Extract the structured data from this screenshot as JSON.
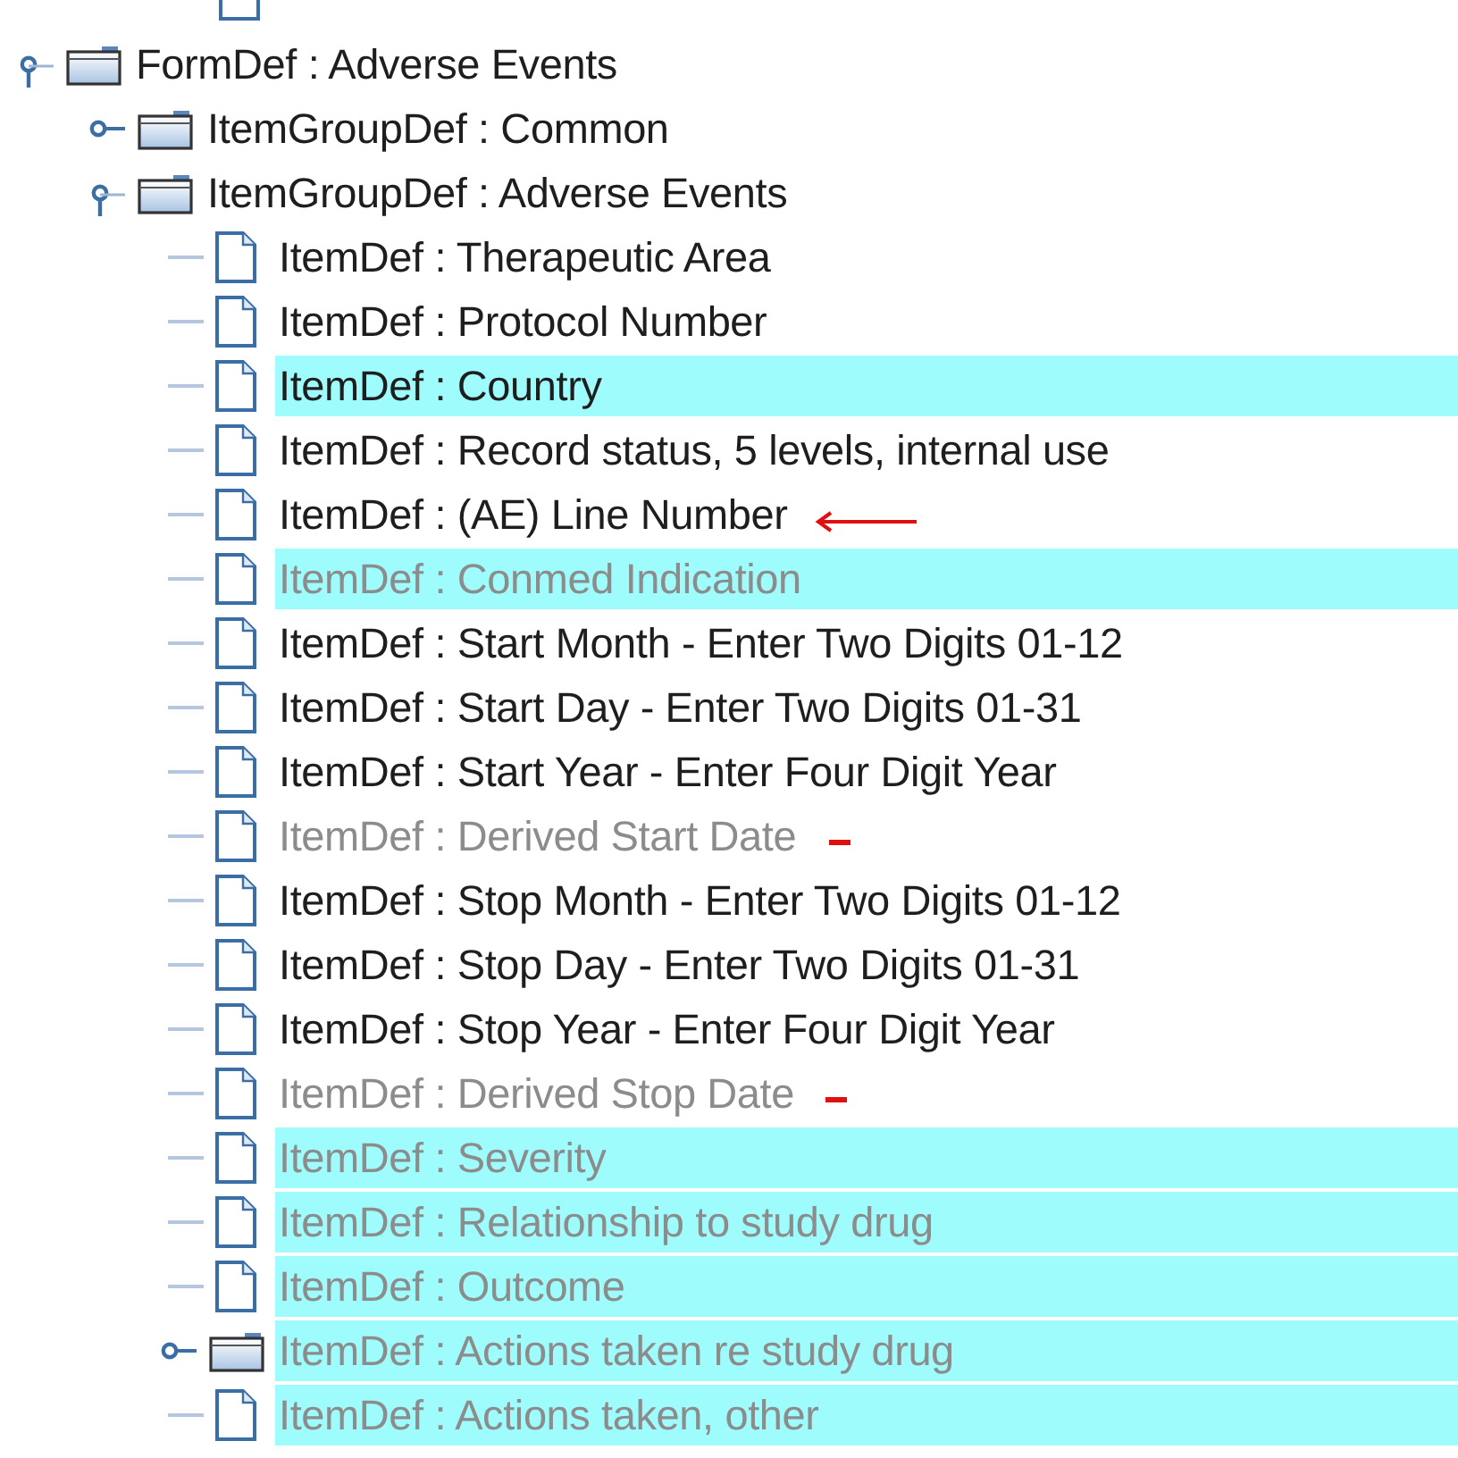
{
  "tree": [
    {
      "kind": "folder",
      "label": "FormDef : Adverse Events",
      "expanded": true,
      "highlighted": false,
      "disabled": false,
      "children": [
        {
          "kind": "folder",
          "label": "ItemGroupDef : Common",
          "expanded": false,
          "highlighted": false,
          "disabled": false
        },
        {
          "kind": "folder",
          "label": "ItemGroupDef : Adverse Events",
          "expanded": true,
          "highlighted": false,
          "disabled": false,
          "children": [
            {
              "kind": "leaf",
              "label": "ItemDef : Therapeutic Area",
              "highlighted": false,
              "disabled": false
            },
            {
              "kind": "leaf",
              "label": "ItemDef : Protocol Number",
              "highlighted": false,
              "disabled": false
            },
            {
              "kind": "leaf",
              "label": "ItemDef : Country",
              "highlighted": true,
              "disabled": false
            },
            {
              "kind": "leaf",
              "label": "ItemDef : Record status, 5 levels, internal use",
              "highlighted": false,
              "disabled": false
            },
            {
              "kind": "leaf",
              "label": "ItemDef : (AE) Line Number",
              "highlighted": false,
              "disabled": false,
              "annotation": {
                "kind": "arrow"
              }
            },
            {
              "kind": "leaf",
              "label": "ItemDef : Conmed Indication",
              "highlighted": true,
              "disabled": true
            },
            {
              "kind": "leaf",
              "label": "ItemDef : Start Month - Enter Two Digits 01-12",
              "highlighted": false,
              "disabled": false
            },
            {
              "kind": "leaf",
              "label": "ItemDef : Start Day - Enter Two Digits 01-31",
              "highlighted": false,
              "disabled": false
            },
            {
              "kind": "leaf",
              "label": "ItemDef : Start Year - Enter Four Digit Year",
              "highlighted": false,
              "disabled": false
            },
            {
              "kind": "leaf",
              "label": "ItemDef : Derived Start Date",
              "highlighted": false,
              "disabled": true,
              "annotation": {
                "kind": "dash"
              }
            },
            {
              "kind": "leaf",
              "label": "ItemDef : Stop Month - Enter Two Digits 01-12",
              "highlighted": false,
              "disabled": false
            },
            {
              "kind": "leaf",
              "label": "ItemDef : Stop Day - Enter Two Digits 01-31",
              "highlighted": false,
              "disabled": false
            },
            {
              "kind": "leaf",
              "label": "ItemDef : Stop Year - Enter Four Digit Year",
              "highlighted": false,
              "disabled": false
            },
            {
              "kind": "leaf",
              "label": "ItemDef : Derived Stop Date",
              "highlighted": false,
              "disabled": true,
              "annotation": {
                "kind": "dash"
              }
            },
            {
              "kind": "leaf",
              "label": "ItemDef : Severity",
              "highlighted": true,
              "disabled": true
            },
            {
              "kind": "leaf",
              "label": "ItemDef : Relationship to study drug",
              "highlighted": true,
              "disabled": true
            },
            {
              "kind": "leaf",
              "label": "ItemDef : Outcome",
              "highlighted": true,
              "disabled": true
            },
            {
              "kind": "folder",
              "label": "ItemDef : Actions taken re study drug",
              "expanded": false,
              "highlighted": true,
              "disabled": true
            },
            {
              "kind": "leaf",
              "label": "ItemDef : Actions taken, other",
              "highlighted": true,
              "disabled": true
            }
          ]
        }
      ]
    }
  ]
}
